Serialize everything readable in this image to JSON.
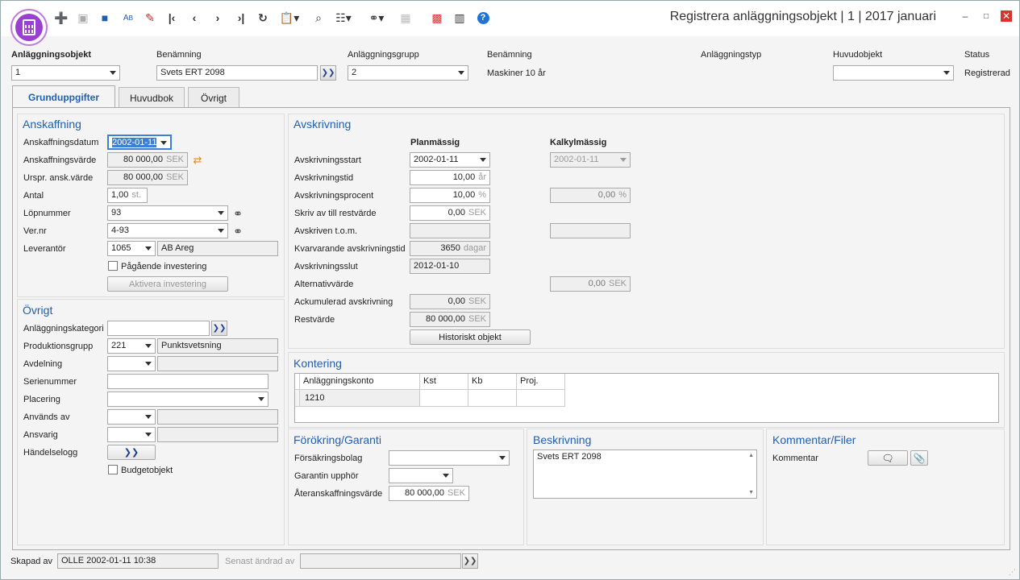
{
  "window": {
    "title": "Registrera anläggningsobjekt | 1 | 2017 januari"
  },
  "toolbar": [
    "new",
    "delete",
    "save",
    "spellcheck",
    "eraser",
    "first",
    "prev",
    "next",
    "last",
    "refresh",
    "clipboard",
    "search",
    "columns",
    "link",
    "table",
    "colors",
    "split",
    "help"
  ],
  "header": {
    "obj_label": "Anläggningsobjekt",
    "obj_value": "1",
    "name_label": "Benämning",
    "name_value": "Svets ERT 2098",
    "group_label": "Anläggningsgrupp",
    "group_value": "2",
    "group_name_label": "Benämning",
    "group_name_value": "Maskiner 10 år",
    "type_label": "Anläggningstyp",
    "main_label": "Huvudobjekt",
    "main_value": "",
    "status_label": "Status",
    "status_value": "Registrerad"
  },
  "tabs": [
    "Grunduppgifter",
    "Huvudbok",
    "Övrigt"
  ],
  "anskaffning": {
    "title": "Anskaffning",
    "date_label": "Anskaffningsdatum",
    "date_value": "2002-01-11",
    "value_label": "Anskaffningsvärde",
    "value_value": "80 000,00",
    "value_unit": "SEK",
    "orig_label": "Urspr. ansk.värde",
    "orig_value": "80 000,00",
    "orig_unit": "SEK",
    "antal_label": "Antal",
    "antal_value": "1,00",
    "antal_unit": "st.",
    "lop_label": "Löpnummer",
    "lop_value": "93",
    "ver_label": "Ver.nr",
    "ver_value": "4-93",
    "lev_label": "Leverantör",
    "lev_value": "1065",
    "lev_name": "AB Areg",
    "pagaende_label": "Pågående investering",
    "aktivera_label": "Aktivera investering"
  },
  "ovrigt": {
    "title": "Övrigt",
    "kat_label": "Anläggningskategori",
    "kat_value": "",
    "prod_label": "Produktionsgrupp",
    "prod_value": "221",
    "prod_name": "Punktsvetsning",
    "avd_label": "Avdelning",
    "serie_label": "Serienummer",
    "plac_label": "Placering",
    "anv_label": "Används av",
    "ansv_label": "Ansvarig",
    "hand_label": "Händelselogg",
    "budget_label": "Budgetobjekt"
  },
  "avskrivning": {
    "title": "Avskrivning",
    "plan_label": "Planmässig",
    "kalk_label": "Kalkylmässig",
    "start_label": "Avskrivningsstart",
    "start_plan": "2002-01-11",
    "start_kalk": "2002-01-11",
    "tid_label": "Avskrivningstid",
    "tid_plan": "10,00",
    "tid_unit": "år",
    "proc_label": "Avskrivningsprocent",
    "proc_plan": "10,00",
    "proc_kalk": "0,00",
    "proc_unit": "%",
    "rest_label": "Skriv av till restvärde",
    "rest_plan": "0,00",
    "sek": "SEK",
    "tom_label": "Avskriven t.o.m.",
    "kvar_label": "Kvarvarande avskrivningstid",
    "kvar_plan": "3650",
    "kvar_unit": "dagar",
    "slut_label": "Avskrivningsslut",
    "slut_plan": "2012-01-10",
    "alt_label": "Alternativvärde",
    "alt_kalk": "0,00",
    "ack_label": "Ackumulerad avskrivning",
    "ack_plan": "0,00",
    "restv_label": "Restvärde",
    "restv_plan": "80 000,00",
    "hist_label": "Historiskt objekt"
  },
  "kontering": {
    "title": "Kontering",
    "columns": [
      "Anläggningskonto",
      "Kst",
      "Kb",
      "Proj."
    ],
    "rows": [
      [
        "1210",
        "",
        "",
        ""
      ]
    ]
  },
  "forsakring": {
    "title": "Förökring/Garanti",
    "bolag_label": "Försäkringsbolag",
    "garanti_label": "Garantin upphör",
    "ater_label": "Återanskaffningsvärde",
    "ater_value": "80 000,00",
    "ater_unit": "SEK"
  },
  "beskrivning": {
    "title": "Beskrivning",
    "text": "Svets ERT 2098"
  },
  "kommentar": {
    "title": "Kommentar/Filer",
    "label": "Kommentar"
  },
  "footer": {
    "skapad_label": "Skapad av",
    "skapad_value": "OLLE 2002-01-11 10:38",
    "andrad_label": "Senast ändrad av",
    "andrad_value": ""
  }
}
